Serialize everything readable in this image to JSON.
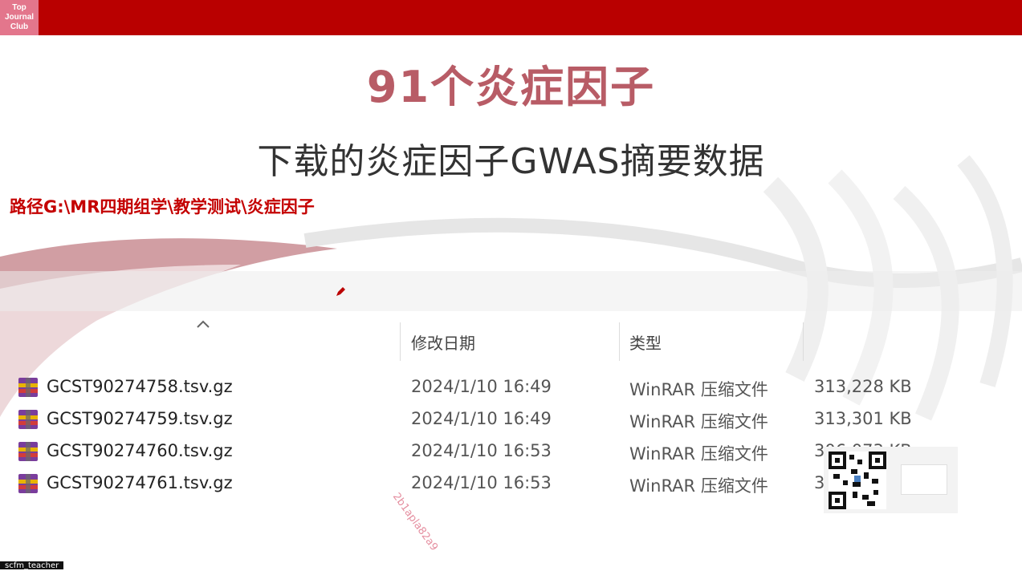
{
  "header": {
    "logo_lines": [
      "Top",
      "Journal",
      "Club"
    ]
  },
  "slide": {
    "title": "91个炎症因子",
    "subtitle": "下载的炎症因子GWAS摘要数据",
    "path": "路径G:\\MR四期组学\\教学测试\\炎症因子"
  },
  "explorer": {
    "columns": {
      "date": "修改日期",
      "type": "类型"
    },
    "files": [
      {
        "name": "GCST90274758.tsv.gz",
        "date": "2024/1/10 16:49",
        "type": "WinRAR 压缩文件",
        "size": "313,228 KB"
      },
      {
        "name": "GCST90274759.tsv.gz",
        "date": "2024/1/10 16:49",
        "type": "WinRAR 压缩文件",
        "size": "313,301 KB"
      },
      {
        "name": "GCST90274760.tsv.gz",
        "date": "2024/1/10 16:53",
        "type": "WinRAR 压缩文件",
        "size": "306,073 KB"
      },
      {
        "name": "GCST90274761.tsv.gz",
        "date": "2024/1/10 16:53",
        "type": "WinRAR 压缩文件",
        "size": "30"
      }
    ]
  },
  "watermark": "2b1apla82a9",
  "streamer_tag": "scfm_teacher",
  "colors": {
    "header_red": "#b90000",
    "title": "#b85c66",
    "path": "#c40000"
  }
}
